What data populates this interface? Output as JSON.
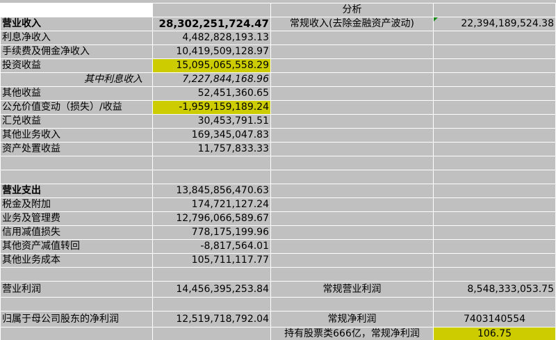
{
  "header": {
    "analysis": "分析"
  },
  "rows": [
    {
      "a": "",
      "b": "",
      "c": "分析",
      "d": ""
    },
    {
      "a": "营业收入",
      "b": "28,302,251,724.47",
      "c": "常规收入(去除金融资产波动)",
      "d": "22,394,189,524.38"
    },
    {
      "a": "利息净收入",
      "b": "4,482,828,193.13",
      "c": "",
      "d": ""
    },
    {
      "a": "手续费及佣金净收入",
      "b": "10,419,509,128.97",
      "c": "",
      "d": ""
    },
    {
      "a": "投资收益",
      "b": "15,095,065,558.29",
      "c": "",
      "d": ""
    },
    {
      "a": "其中利息收入",
      "b": "7,227,844,168.96",
      "c": "",
      "d": ""
    },
    {
      "a": "其他收益",
      "b": "52,451,360.65",
      "c": "",
      "d": ""
    },
    {
      "a": "公允价值变动（损失）/收益",
      "b": "-1,959,159,189.24",
      "c": "",
      "d": ""
    },
    {
      "a": "汇兑收益",
      "b": "30,453,791.51",
      "c": "",
      "d": ""
    },
    {
      "a": "其他业务收入",
      "b": "169,345,047.83",
      "c": "",
      "d": ""
    },
    {
      "a": "资产处置收益",
      "b": "11,757,833.33",
      "c": "",
      "d": ""
    },
    {
      "a": "",
      "b": "",
      "c": "",
      "d": ""
    },
    {
      "a": "",
      "b": "",
      "c": "",
      "d": ""
    },
    {
      "a": "营业支出",
      "b": "13,845,856,470.63",
      "c": "",
      "d": ""
    },
    {
      "a": "税金及附加",
      "b": "174,721,127.24",
      "c": "",
      "d": ""
    },
    {
      "a": "业务及管理费",
      "b": "12,796,066,589.67",
      "c": "",
      "d": ""
    },
    {
      "a": "信用减值损失",
      "b": "778,175,199.96",
      "c": "",
      "d": ""
    },
    {
      "a": "其他资产减值转回",
      "b": "-8,817,564.01",
      "c": "",
      "d": ""
    },
    {
      "a": "其他业务成本",
      "b": "105,711,117.77",
      "c": "",
      "d": ""
    },
    {
      "a": "",
      "b": "",
      "c": "",
      "d": ""
    },
    {
      "a": "营业利润",
      "b": "14,456,395,253.84",
      "c": "常规营业利润",
      "d": "8,548,333,053.75"
    },
    {
      "a": "",
      "b": "",
      "c": "",
      "d": ""
    },
    {
      "a": "归属于母公司股东的净利润",
      "b": "12,519,718,792.04",
      "c": "常规净利润",
      "d": "7403140554"
    },
    {
      "a": "",
      "b": "",
      "c": "持有股票类666亿，常规净利润",
      "d": "106.75"
    }
  ],
  "colors": {
    "grid": "#c0c0c0",
    "highlight": "#cccc00",
    "border": "#ffffff"
  }
}
